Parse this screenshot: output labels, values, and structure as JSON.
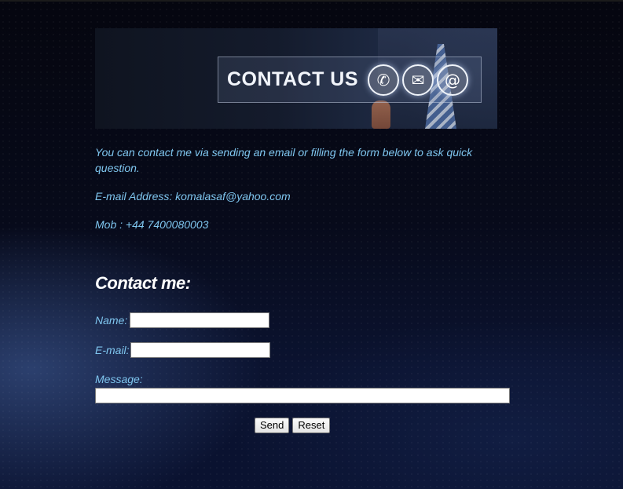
{
  "banner": {
    "title": "CONTACT US",
    "icons": [
      "phone-icon",
      "mail-icon",
      "at-icon"
    ],
    "icon_glyphs": [
      "✆",
      "✉",
      "@"
    ]
  },
  "intro": {
    "text": "You can contact me via sending an email or filling the form below to ask quick question.",
    "email_line": "E-mail Address: komalasaf@yahoo.com",
    "mobile_line": "Mob : +44 7400080003"
  },
  "form": {
    "heading": "Contact me:",
    "name_label": "Name:",
    "name_value": "",
    "email_label": "E-mail:",
    "email_value": "",
    "message_label": "Message:",
    "message_value": "",
    "send_label": "Send",
    "reset_label": "Reset"
  },
  "colors": {
    "text_accent": "#7fc6ef",
    "heading": "#ffffff",
    "background": "#070a1a"
  }
}
